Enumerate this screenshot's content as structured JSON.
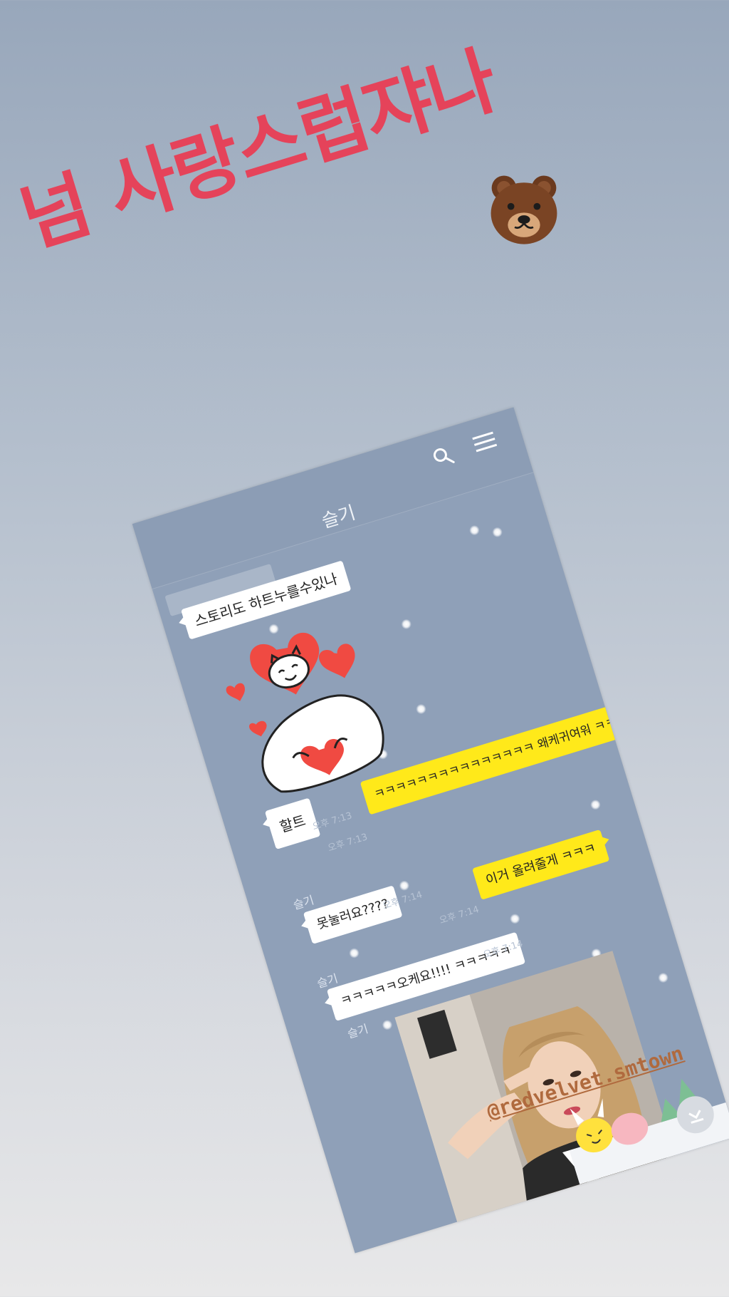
{
  "headline": {
    "text": "넘 사랑스럽쟈나",
    "emoji": "bear-face-emoji",
    "color": "#e5435a"
  },
  "phone": {
    "chat_title": "슬기",
    "icons": [
      "search-icon",
      "menu-icon"
    ],
    "messages": [
      {
        "side": "left",
        "text": "스토리도 하트누를수있나"
      },
      {
        "side": "left",
        "type": "sticker",
        "icon": "heart-hug-sticker"
      },
      {
        "side": "left",
        "text": "할트",
        "time": "오후 7:13"
      },
      {
        "side": "right",
        "text": "ㅋㅋㅋㅋㅋㅋㅋㅋㅋㅋㅋㅋㅋㅋㅋ 왜케귀여워 ㅋㅋ",
        "time": "오후 7:13"
      },
      {
        "side": "left",
        "sender": "슬기",
        "text": "못눌러요????",
        "time": "오후 7:14"
      },
      {
        "side": "right",
        "text": "이거 올려줄게 ㅋㅋㅋ",
        "time": "오후 7:14"
      },
      {
        "side": "left",
        "sender": "슬기",
        "text": "ㅋㅋㅋㅋㅋ오케요!!!! ㅋㅋㅋㅋㅋ",
        "time": "오후 7:14"
      },
      {
        "side": "left",
        "sender": "슬기",
        "type": "photo",
        "icon": "selfie-photo"
      }
    ],
    "scroll_button_icon": "scroll-down-icon"
  },
  "handle": {
    "text": "@redvelvet.smtown",
    "color": "#b06a3e"
  },
  "colors": {
    "chat_bg": "#8fa0b8",
    "yellow_bubble": "#ffe91a",
    "white_bubble": "#ffffff"
  }
}
